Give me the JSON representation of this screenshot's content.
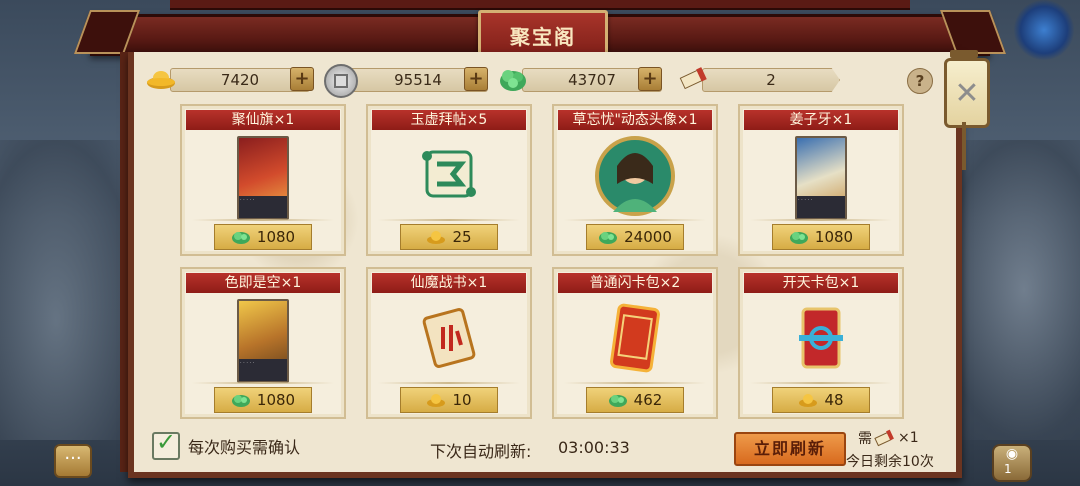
{
  "title": "聚宝阁",
  "currencies": [
    {
      "icon": "gold-ingot-icon",
      "value": "7420"
    },
    {
      "icon": "silver-coin-icon",
      "value": "95514"
    },
    {
      "icon": "jade-icon",
      "value": "43707"
    },
    {
      "icon": "scroll-token-icon",
      "value": "2"
    }
  ],
  "items": [
    {
      "name": "聚仙旗×1",
      "art": "card-item",
      "currency": "jade-icon",
      "price": "1080"
    },
    {
      "name": "玉虚拜帖×5",
      "art": "scroll-item",
      "currency": "gold-ingot-icon",
      "price": "25"
    },
    {
      "name": "草忘忧\"动态头像×1",
      "art": "avatar-item",
      "currency": "jade-icon",
      "price": "24000"
    },
    {
      "name": "姜子牙×1",
      "art": "card-item",
      "currency": "jade-icon",
      "price": "1080"
    },
    {
      "name": "色即是空×1",
      "art": "card-item",
      "currency": "jade-icon",
      "price": "1080"
    },
    {
      "name": "仙魔战书×1",
      "art": "scroll-item",
      "currency": "gold-ingot-icon",
      "price": "10"
    },
    {
      "name": "普通闪卡包×2",
      "art": "pack-item",
      "currency": "jade-icon",
      "price": "462"
    },
    {
      "name": "开天卡包×1",
      "art": "pack-item",
      "currency": "gold-ingot-icon",
      "price": "48"
    }
  ],
  "footer": {
    "confirm_label": "每次购买需确认",
    "auto_refresh_label": "下次自动刷新:",
    "auto_refresh_time": "03:00:33",
    "refresh_button": "立即刷新",
    "need_label": "需",
    "need_count": "×1",
    "remaining": "今日剩余10次"
  },
  "help_label": "?",
  "bag_count": "1",
  "colors": {
    "title_red": "#8e1c17",
    "panel_bg": "#efe6d1",
    "price_gold": "#d6ac45",
    "refresh_orange": "#d86a1e"
  }
}
